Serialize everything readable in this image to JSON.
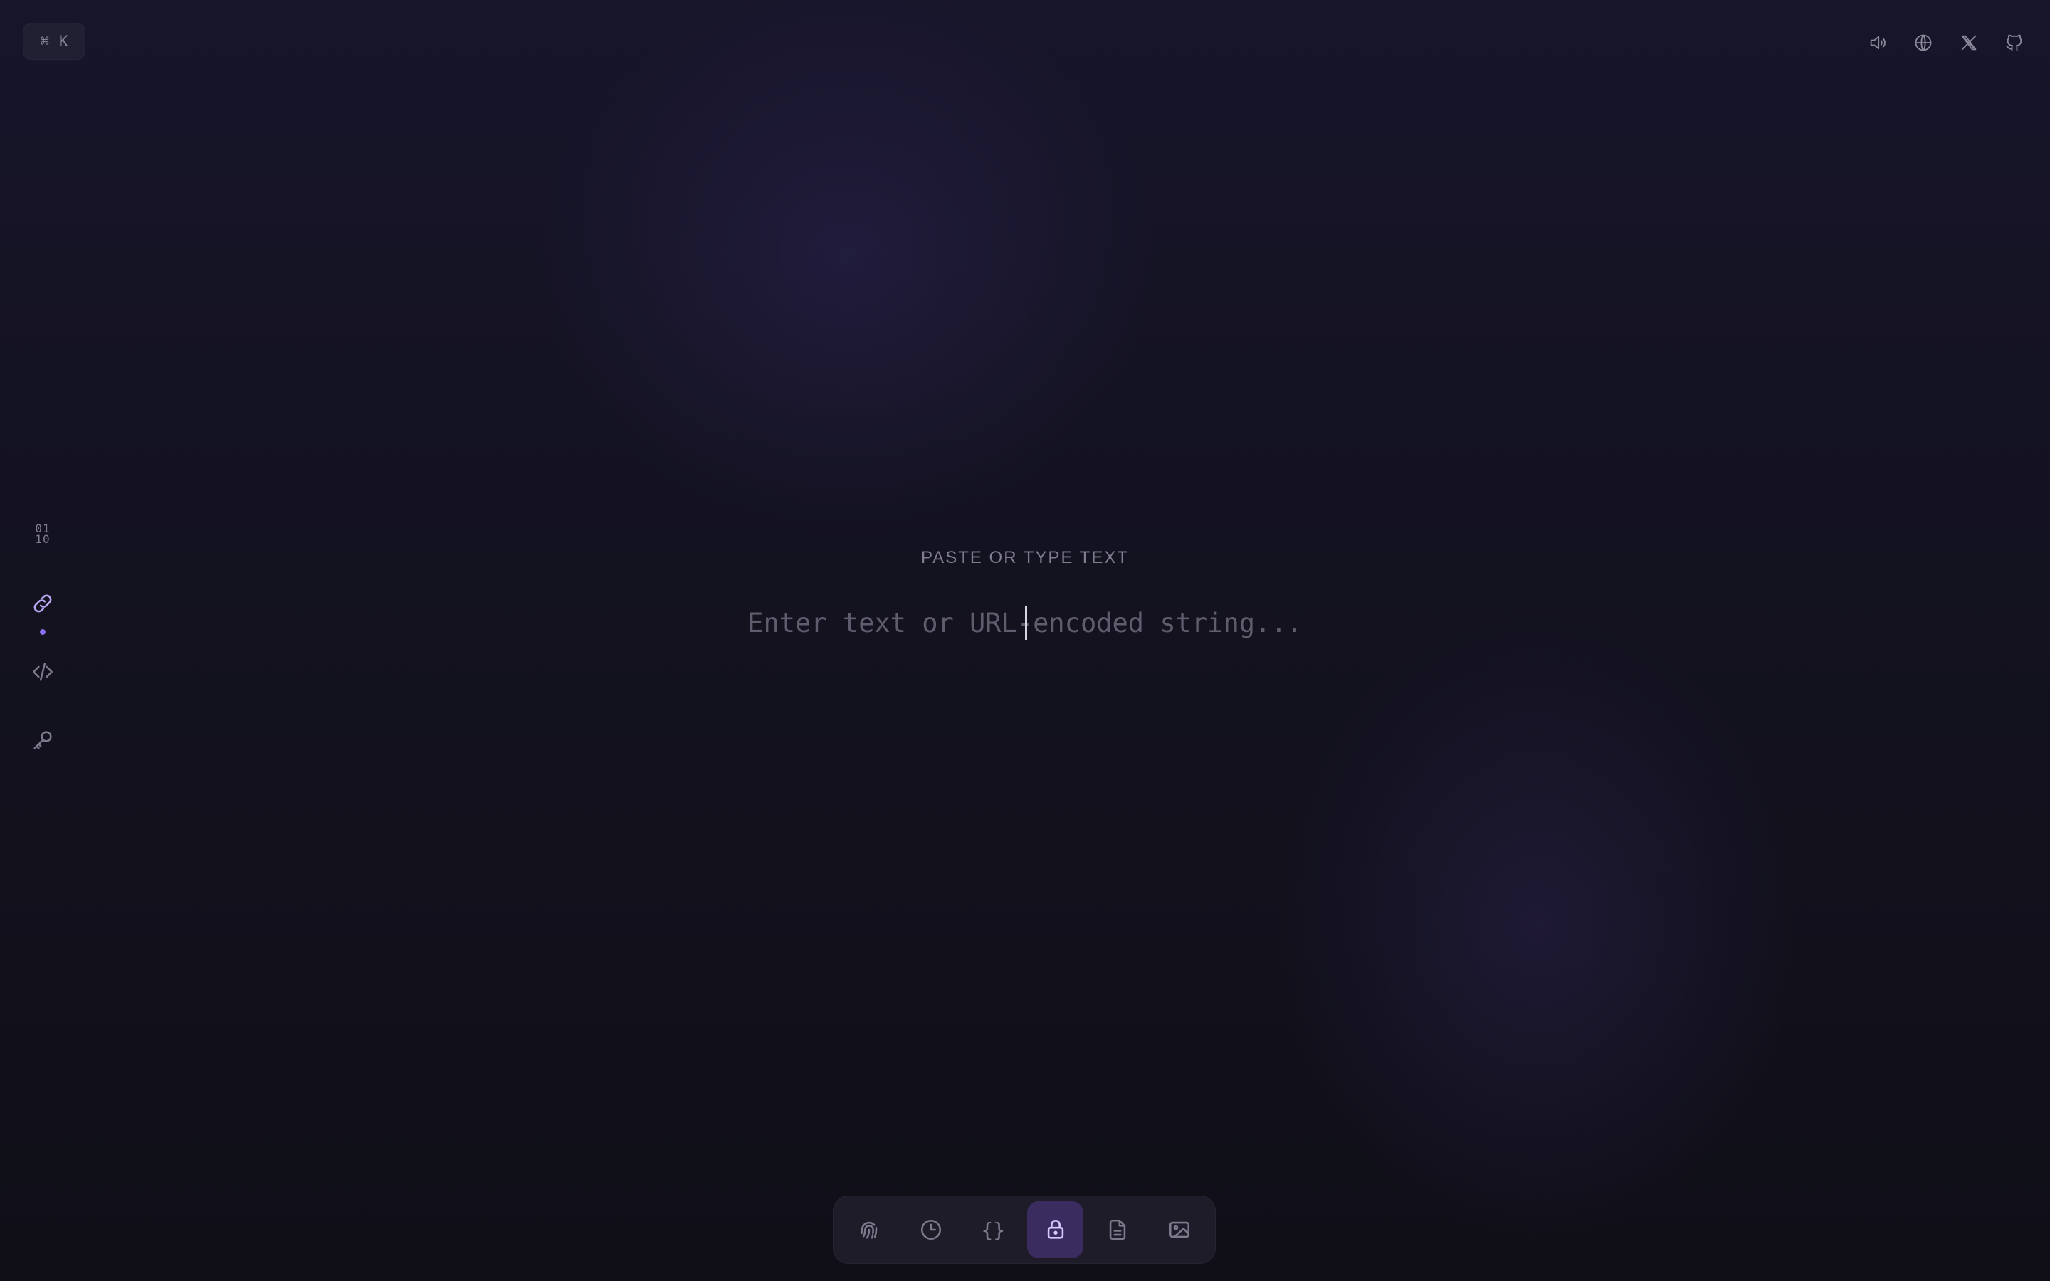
{
  "shortcut": {
    "cmd_symbol": "⌘",
    "key": "K"
  },
  "top_right_icons": [
    "speaker-icon",
    "globe-icon",
    "x-logo-icon",
    "github-icon"
  ],
  "sidebar": {
    "items": [
      {
        "name": "binary",
        "label_top": "01",
        "label_bottom": "10",
        "active": false
      },
      {
        "name": "url-encode",
        "icon": "link-icon",
        "active": true
      },
      {
        "name": "html",
        "icon": "code-icon",
        "active": false
      },
      {
        "name": "jwt",
        "icon": "key-icon",
        "active": false
      }
    ]
  },
  "main": {
    "label": "PASTE OR TYPE TEXT",
    "input_value": "",
    "input_placeholder": "Enter text or URL-encoded string..."
  },
  "dock": {
    "items": [
      {
        "icon": "fingerprint-icon",
        "active": false
      },
      {
        "icon": "clock-icon",
        "active": false
      },
      {
        "icon": "braces-icon",
        "text": "{}",
        "active": false
      },
      {
        "icon": "lock-icon",
        "active": true
      },
      {
        "icon": "document-icon",
        "active": false
      },
      {
        "icon": "image-icon",
        "active": false
      }
    ]
  },
  "colors": {
    "background": "#111019",
    "accent": "#8a6ef0",
    "active_dock_bg": "#3a2c5f",
    "muted_text": "#807d91"
  }
}
